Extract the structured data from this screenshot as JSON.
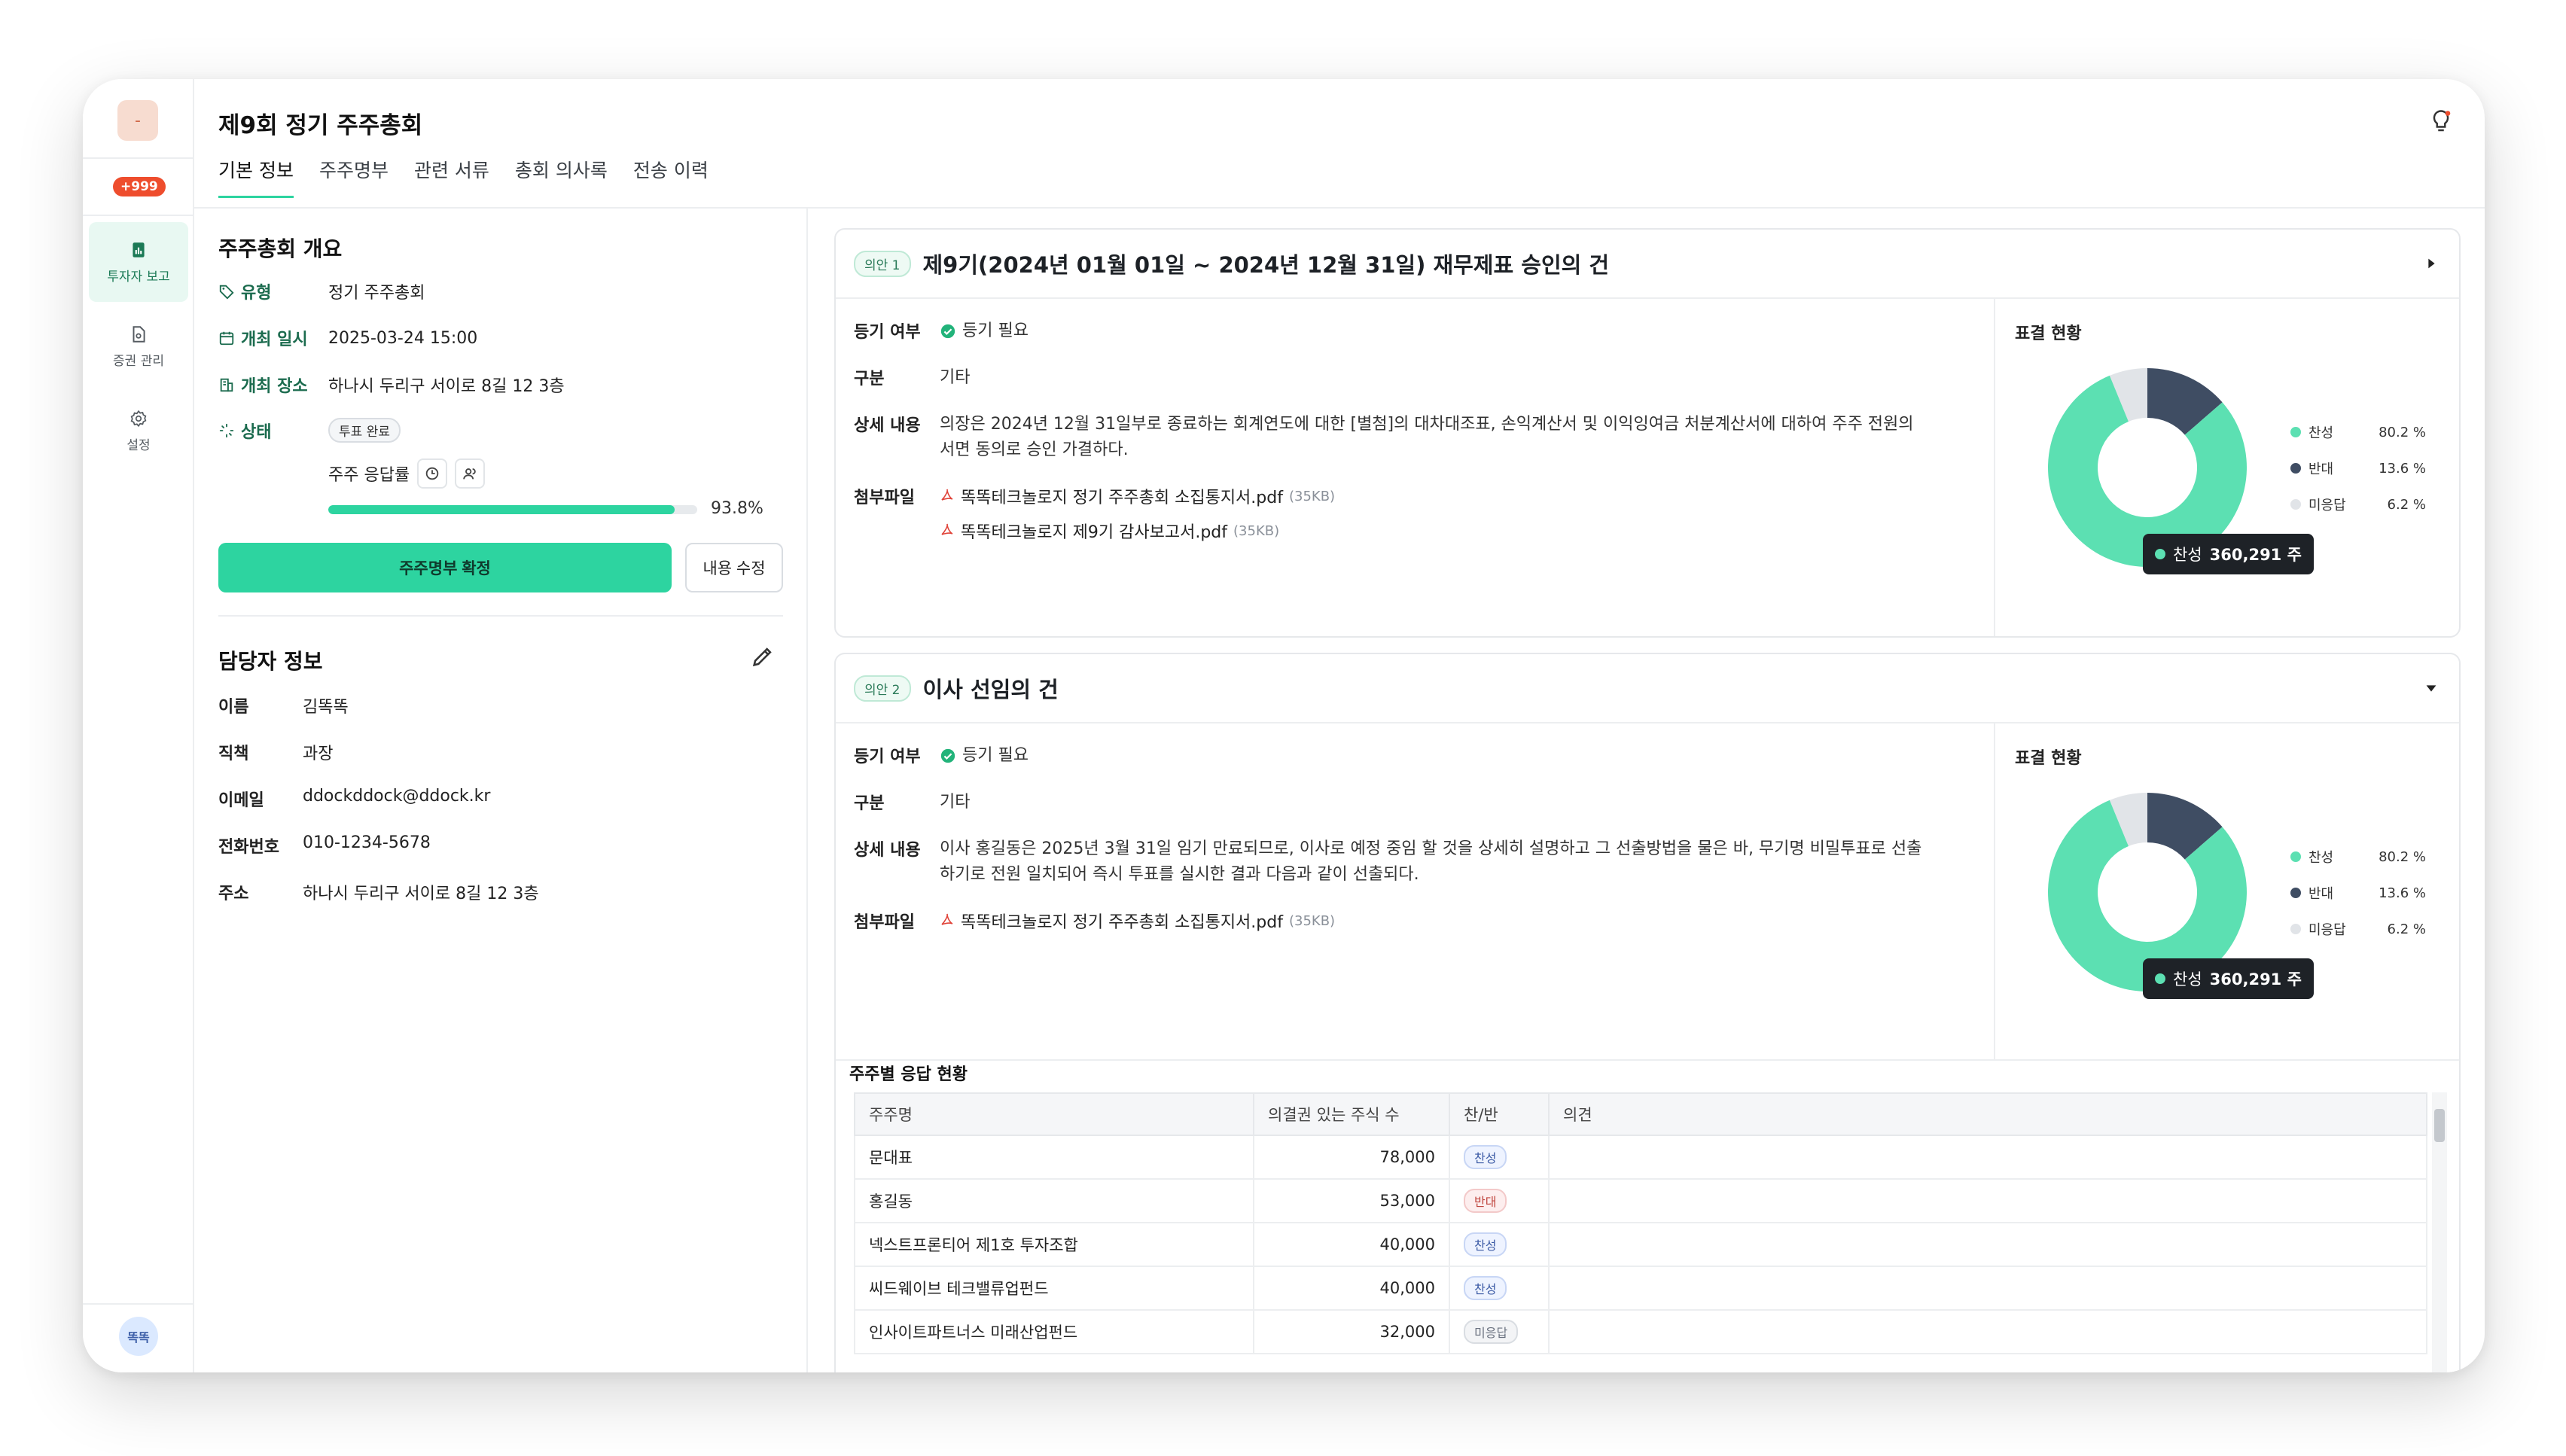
{
  "sidebar": {
    "logo_text": "-",
    "badge": "+999",
    "items": [
      {
        "label": "투자자 보고",
        "icon": "report-icon"
      },
      {
        "label": "증권 관리",
        "icon": "document-icon"
      },
      {
        "label": "설정",
        "icon": "gear-icon"
      }
    ],
    "avatar": "똑똑"
  },
  "header": {
    "title": "제9회 정기 주주총회",
    "tabs": [
      "기본 정보",
      "주주명부",
      "관련 서류",
      "총회 의사록",
      "전송 이력"
    ],
    "active_tab": "기본 정보"
  },
  "overview": {
    "title": "주주총회 개요",
    "type_label": "유형",
    "type_value": "정기 주주총회",
    "date_label": "개최 일시",
    "date_value": "2025-03-24 15:00",
    "place_label": "개최 장소",
    "place_value": "하나시 두리구 서이로 8길 12 3층",
    "status_label": "상태",
    "status_value": "투표 완료",
    "response_label": "주주 응답률",
    "response_rate": 93.8,
    "response_pct_text": "93.8%",
    "confirm_button": "주주명부 확정",
    "edit_button": "내용 수정"
  },
  "contact": {
    "title": "담당자 정보",
    "rows": [
      {
        "label": "이름",
        "value": "김똑똑"
      },
      {
        "label": "직책",
        "value": "과장"
      },
      {
        "label": "이메일",
        "value": "ddockddock@ddock.kr"
      },
      {
        "label": "전화번호",
        "value": "010-1234-5678"
      },
      {
        "label": "주소",
        "value": "하나시 두리구 서이로 8길 12 3층"
      }
    ]
  },
  "agendas": [
    {
      "tag": "의안 1",
      "title": "제9기(2024년 01월 01일 ~ 2024년 12월 31일) 재무제표 승인의 건",
      "reg_label": "등기 여부",
      "reg_value": "등기 필요",
      "type_label": "구분",
      "type_value": "기타",
      "detail_label": "상세 내용",
      "detail_value": "의장은 2024년 12월 31일부로 종료하는 회계연도에 대한 [별첨]의 대차대조표, 손익계산서 및 이익잉여금 처분계산서에 대하여 주주 전원의 서면 동의로 승인 가결하다.",
      "files_label": "첨부파일",
      "files": [
        {
          "name": "똑똑테크놀로지 정기 주주총회 소집통지서.pdf",
          "size": "(35KB)"
        },
        {
          "name": "똑똑테크놀로지 제9기 감사보고서.pdf",
          "size": "(35KB)"
        }
      ],
      "vote_title": "표결 현황",
      "tooltip_label": "찬성",
      "tooltip_value": "360,291 주"
    },
    {
      "tag": "의안 2",
      "title": "이사 선임의 건",
      "reg_label": "등기 여부",
      "reg_value": "등기 필요",
      "type_label": "구분",
      "type_value": "기타",
      "detail_label": "상세 내용",
      "detail_value": "이사 홍길동은 2025년 3월 31일 임기 만료되므로, 이사로 예정 중임 할 것을 상세히 설명하고 그 선출방법을 물은 바, 무기명 비밀투표로 선출하기로 전원 일치되어 즉시 투표를 실시한 결과 다음과 같이 선출되다.",
      "files_label": "첨부파일",
      "files": [
        {
          "name": "똑똑테크놀로지 정기 주주총회 소집통지서.pdf",
          "size": "(35KB)"
        }
      ],
      "vote_title": "표결 현황",
      "tooltip_label": "찬성",
      "tooltip_value": "360,291 주"
    }
  ],
  "chart_data": [
    {
      "type": "pie",
      "categories": [
        "찬성",
        "반대",
        "미응답"
      ],
      "values": [
        80.2,
        13.6,
        6.2
      ],
      "value_labels": [
        "80.2 %",
        "13.6 %",
        "6.2 %"
      ],
      "colors": [
        "#5ce0b2",
        "#3f4d63",
        "#e1e4e8"
      ],
      "legend": "right"
    },
    {
      "type": "pie",
      "categories": [
        "찬성",
        "반대",
        "미응답"
      ],
      "values": [
        80.2,
        13.6,
        6.2
      ],
      "value_labels": [
        "80.2 %",
        "13.6 %",
        "6.2 %"
      ],
      "colors": [
        "#5ce0b2",
        "#3f4d63",
        "#e1e4e8"
      ],
      "legend": "right"
    }
  ],
  "responses": {
    "title": "주주별 응답 현황",
    "columns": [
      "주주명",
      "의결권 있는 주식 수",
      "찬/반",
      "의견"
    ],
    "rows": [
      {
        "name": "문대표",
        "shares": "78,000",
        "vote": "찬성",
        "opinion": ""
      },
      {
        "name": "홍길동",
        "shares": "53,000",
        "vote": "반대",
        "opinion": ""
      },
      {
        "name": "넥스트프론티어 제1호 투자조합",
        "shares": "40,000",
        "vote": "찬성",
        "opinion": ""
      },
      {
        "name": "씨드웨이브 테크밸류업펀드",
        "shares": "40,000",
        "vote": "찬성",
        "opinion": ""
      },
      {
        "name": "인사이트파트너스 미래산업펀드",
        "shares": "32,000",
        "vote": "미응답",
        "opinion": ""
      }
    ]
  },
  "colors": {
    "accent": "#2dd4a0",
    "approve": "#5ce0b2",
    "reject": "#3f4d63",
    "no_response": "#e1e4e8"
  }
}
